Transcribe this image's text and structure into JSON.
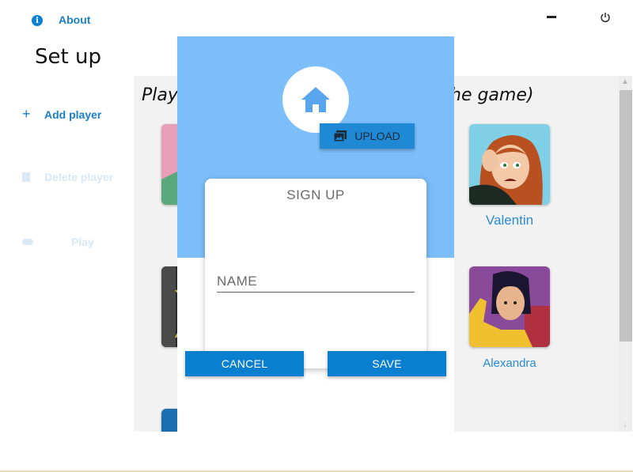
{
  "header": {
    "about_label": "About",
    "page_title": "Set up"
  },
  "sidebar": {
    "items": [
      {
        "label": "Add player",
        "icon": "plus-icon",
        "enabled": true
      },
      {
        "label": "Delete player",
        "icon": "trash-icon",
        "enabled": false
      },
      {
        "label": "Play",
        "icon": "gamepad-icon",
        "enabled": false
      }
    ]
  },
  "players_panel": {
    "heading_left": "Play",
    "heading_right": "he game)",
    "players": [
      {
        "name": "Valentin"
      },
      {
        "name": "Alexandra"
      }
    ]
  },
  "signup_dialog": {
    "upload_label": "UPLOAD",
    "title": "SIGN UP",
    "name_placeholder": "NAME",
    "name_value": "",
    "cancel_label": "CANCEL",
    "save_label": "SAVE"
  },
  "colors": {
    "accent": "#0b7fcf",
    "overlay_header": "#7cbef9",
    "panel_bg": "#f2f2f2",
    "link": "#1a7fc8"
  }
}
